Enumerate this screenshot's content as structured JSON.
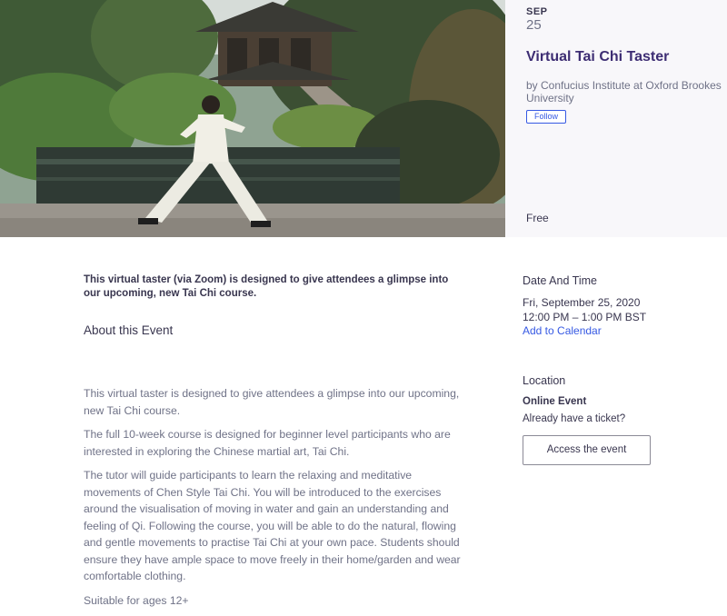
{
  "event": {
    "month": "SEP",
    "day": "25",
    "title": "Virtual Tai Chi Taster",
    "organizer": "by Confucius Institute at Oxford Brookes University",
    "follow_label": "Follow",
    "price": "Free"
  },
  "main": {
    "summary": "This virtual taster (via Zoom) is designed to give attendees a glimpse into our upcoming, new Tai Chi course.",
    "about_heading": "About this Event",
    "paragraphs": [
      "This virtual taster is designed to give attendees a glimpse into our upcoming, new Tai Chi course.",
      "The full 10-week course is designed for beginner level participants who are interested in exploring the Chinese martial art, Tai Chi.",
      "The tutor will guide participants to learn the relaxing and meditative movements of Chen Style Tai Chi. You will be introduced to the exercises around the visualisation of moving in water and gain an understanding and feeling of Qi. Following the course, you will be able to do the natural, flowing and gentle movements to practise Tai Chi at your own pace. Students should ensure they have ample space to move freely in their home/garden and wear comfortable clothing.",
      "Suitable for ages 12+"
    ]
  },
  "sidebar": {
    "date_heading": "Date And Time",
    "date": "Fri, September 25, 2020",
    "time": "12:00 PM – 1:00 PM BST",
    "add_calendar": "Add to Calendar",
    "location_heading": "Location",
    "location": "Online Event",
    "ticket_question": "Already have a ticket?",
    "access_button": "Access the event"
  },
  "colors": {
    "accent": "#3659e3",
    "title": "#3d2d73",
    "text": "#39364f",
    "muted": "#6f7287",
    "panel": "#f8f7fa"
  }
}
